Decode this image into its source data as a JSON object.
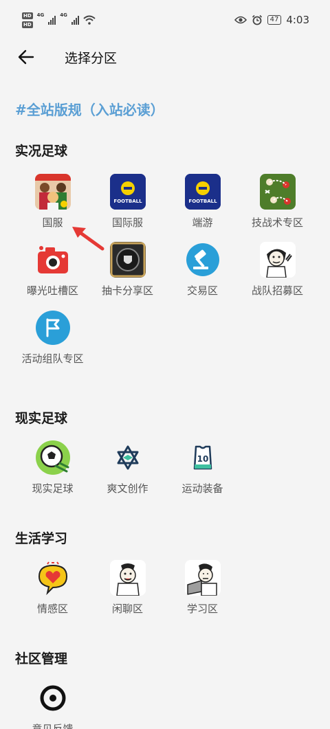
{
  "status_bar": {
    "hd1": "HD",
    "hd2": "HD",
    "net1": "4G",
    "net2": "4G",
    "battery": "47",
    "time": "4:03"
  },
  "header": {
    "title": "选择分区"
  },
  "rules_link": "#全站版规（入站必读）",
  "sections": [
    {
      "title": "实况足球",
      "items": [
        {
          "label": "国服",
          "icon": "efootball-players-icon"
        },
        {
          "label": "国际服",
          "icon": "efootball-logo-icon",
          "logo_text": "FOOTBALL"
        },
        {
          "label": "端游",
          "icon": "efootball-logo-icon",
          "logo_text": "FOOTBALL"
        },
        {
          "label": "技战术专区",
          "icon": "tactics-board-icon"
        },
        {
          "label": "曝光吐槽区",
          "icon": "camera-icon"
        },
        {
          "label": "抽卡分享区",
          "icon": "card-badge-icon"
        },
        {
          "label": "交易区",
          "icon": "auction-hammer-icon"
        },
        {
          "label": "战队招募区",
          "icon": "meme-face-icon"
        },
        {
          "label": "活动组队专区",
          "icon": "flag-icon"
        }
      ]
    },
    {
      "title": "现实足球",
      "items": [
        {
          "label": "现实足球",
          "icon": "soccer-ball-icon"
        },
        {
          "label": "爽文创作",
          "icon": "star-of-david-icon"
        },
        {
          "label": "运动装备",
          "icon": "jersey-icon",
          "jersey_number": "10"
        }
      ]
    },
    {
      "title": "生活学习",
      "items": [
        {
          "label": "情感区",
          "icon": "heart-bubble-icon"
        },
        {
          "label": "闲聊区",
          "icon": "chat-meme-icon"
        },
        {
          "label": "学习区",
          "icon": "study-meme-icon"
        }
      ]
    },
    {
      "title": "社区管理",
      "items": [
        {
          "label": "意见反馈",
          "icon": "feedback-ring-icon"
        }
      ]
    }
  ],
  "colors": {
    "background": "#f4f4f4",
    "rules_link": "#5b9fd4",
    "arrow": "#e53935",
    "efootball_blue": "#1b2f8a",
    "efootball_yellow": "#f5d000"
  }
}
